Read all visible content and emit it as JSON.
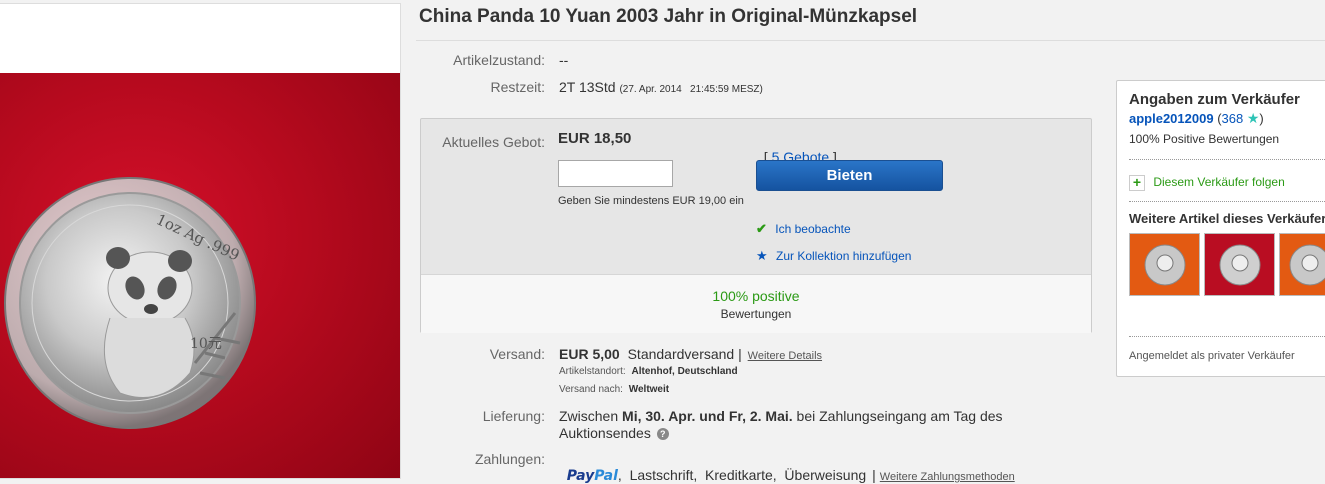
{
  "item": {
    "title": "China Panda 10 Yuan 2003 Jahr in Original-Münzkapsel",
    "coin_text": "1oz Ag .999",
    "coin_value": "10元"
  },
  "details": {
    "condition_label": "Artikelzustand:",
    "condition_value": "--",
    "time_label": "Restzeit:",
    "time_value": "2T 13Std",
    "time_end": "(27. Apr. 2014   21:45:59 MESZ)"
  },
  "bid": {
    "current_label": "Aktuelles Gebot:",
    "current_value": "EUR 18,50",
    "bids_open": "[ ",
    "bids_link": "5 Gebote",
    "bids_close": " ]",
    "input_value": "",
    "button_label": "Bieten",
    "min_hint": "Geben Sie mindestens EUR 19,00 ein",
    "watch_label": "Ich beobachte",
    "collection_label": "Zur Kollektion hinzufügen",
    "positive_pct": "100% positive",
    "positive_label": "Bewertungen"
  },
  "shipping": {
    "label": "Versand:",
    "cost": "EUR 5,00",
    "method": "Standardversand |",
    "details_link": "Weitere Details",
    "location_label": "Artikelstandort:",
    "location_value": "Altenhof, Deutschland",
    "ships_to_label": "Versand nach:",
    "ships_to_value": "Weltweit"
  },
  "delivery": {
    "label": "Lieferung:",
    "pre": "Zwischen ",
    "dates": "Mi, 30. Apr. und Fr, 2. Mai.",
    "post": " bei Zahlungseingang am Tag des",
    "line2": "Auktionsendes"
  },
  "payment": {
    "label": "Zahlungen:",
    "paypal_pay": "Pay",
    "paypal_pal": "Pal",
    "methods": ",  Lastschrift,  Kreditkarte,  Überweisung",
    "sep": "|",
    "more_link": "Weitere Zahlungsmethoden"
  },
  "seller": {
    "heading": "Angaben zum Verkäufer",
    "username": "apple2012009",
    "score_open": " (",
    "score": "368",
    "score_close": ")",
    "feedback": "100% Positive Bewertungen",
    "follow": "Diesem Verkäufer folgen",
    "more_heading": "Weitere Artikel dieses Verkäufers",
    "private": "Angemeldet als privater Verkäufer"
  },
  "colors": {
    "link": "#0654ba",
    "positive": "#2b9a15",
    "button": "#1553a0",
    "seller_star": "#2ec4b6",
    "background_red": "#b60a1e"
  },
  "icons": {
    "check": "check-icon",
    "collection": "star-icon",
    "follow": "plus-icon",
    "help": "question-icon",
    "seller_star": "star-icon"
  }
}
